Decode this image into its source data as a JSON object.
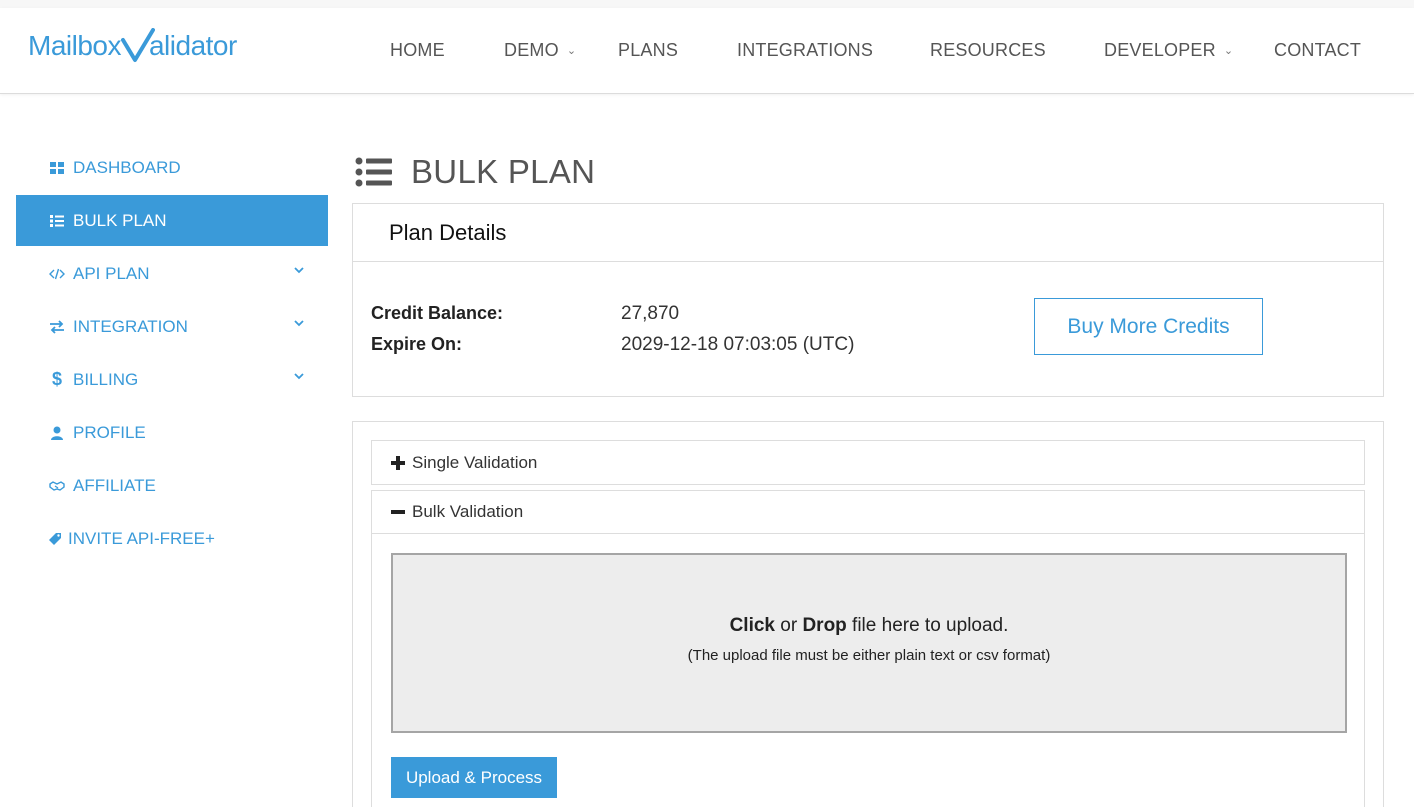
{
  "brand": {
    "name_part1": "Mailbox",
    "name_part2": "alidator",
    "accent_color": "#3a9ad9"
  },
  "nav": {
    "items": [
      {
        "label": "HOME",
        "has_dropdown": false
      },
      {
        "label": "DEMO",
        "has_dropdown": true
      },
      {
        "label": "PLANS",
        "has_dropdown": false
      },
      {
        "label": "INTEGRATIONS",
        "has_dropdown": false
      },
      {
        "label": "RESOURCES",
        "has_dropdown": false
      },
      {
        "label": "DEVELOPER",
        "has_dropdown": true
      },
      {
        "label": "CONTACT",
        "has_dropdown": false
      }
    ]
  },
  "sidebar": {
    "items": [
      {
        "label": "DASHBOARD",
        "icon": "dashboard-icon",
        "active": false,
        "expandable": false
      },
      {
        "label": "BULK PLAN",
        "icon": "list-icon",
        "active": true,
        "expandable": false
      },
      {
        "label": "API PLAN",
        "icon": "code-icon",
        "active": false,
        "expandable": true
      },
      {
        "label": "INTEGRATION",
        "icon": "exchange-icon",
        "active": false,
        "expandable": true
      },
      {
        "label": "BILLING",
        "icon": "dollar-icon",
        "active": false,
        "expandable": true
      },
      {
        "label": "PROFILE",
        "icon": "user-icon",
        "active": false,
        "expandable": false
      },
      {
        "label": "AFFILIATE",
        "icon": "handshake-icon",
        "active": false,
        "expandable": false
      },
      {
        "label": "INVITE API-FREE+",
        "icon": "tag-icon",
        "active": false,
        "expandable": false
      }
    ]
  },
  "main": {
    "title": "BULK PLAN",
    "plan_details": {
      "heading": "Plan Details",
      "credit_balance_label": "Credit Balance:",
      "credit_balance_value": "27,870",
      "expire_label": "Expire On:",
      "expire_value": "2029-12-18 07:03:05 (UTC)",
      "buy_button": "Buy More Credits"
    },
    "accordion": {
      "single": {
        "label": "Single Validation",
        "expanded": false
      },
      "bulk": {
        "label": "Bulk Validation",
        "expanded": true
      }
    },
    "dropzone": {
      "click": "Click",
      "or": " or ",
      "drop": "Drop",
      "rest": " file here to upload.",
      "note": "(The upload file must be either plain text or csv format)"
    },
    "upload_button": "Upload & Process"
  }
}
